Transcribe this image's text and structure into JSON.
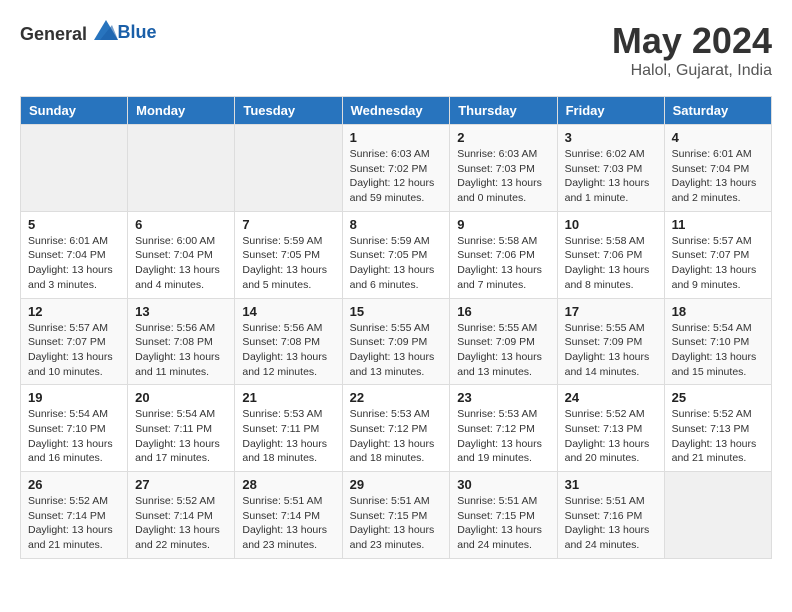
{
  "header": {
    "logo_general": "General",
    "logo_blue": "Blue",
    "title": "May 2024",
    "subtitle": "Halol, Gujarat, India"
  },
  "weekdays": [
    "Sunday",
    "Monday",
    "Tuesday",
    "Wednesday",
    "Thursday",
    "Friday",
    "Saturday"
  ],
  "weeks": [
    [
      {
        "day": "",
        "sunrise": "",
        "sunset": "",
        "daylight": ""
      },
      {
        "day": "",
        "sunrise": "",
        "sunset": "",
        "daylight": ""
      },
      {
        "day": "",
        "sunrise": "",
        "sunset": "",
        "daylight": ""
      },
      {
        "day": "1",
        "sunrise": "Sunrise: 6:03 AM",
        "sunset": "Sunset: 7:02 PM",
        "daylight": "Daylight: 12 hours and 59 minutes."
      },
      {
        "day": "2",
        "sunrise": "Sunrise: 6:03 AM",
        "sunset": "Sunset: 7:03 PM",
        "daylight": "Daylight: 13 hours and 0 minutes."
      },
      {
        "day": "3",
        "sunrise": "Sunrise: 6:02 AM",
        "sunset": "Sunset: 7:03 PM",
        "daylight": "Daylight: 13 hours and 1 minute."
      },
      {
        "day": "4",
        "sunrise": "Sunrise: 6:01 AM",
        "sunset": "Sunset: 7:04 PM",
        "daylight": "Daylight: 13 hours and 2 minutes."
      }
    ],
    [
      {
        "day": "5",
        "sunrise": "Sunrise: 6:01 AM",
        "sunset": "Sunset: 7:04 PM",
        "daylight": "Daylight: 13 hours and 3 minutes."
      },
      {
        "day": "6",
        "sunrise": "Sunrise: 6:00 AM",
        "sunset": "Sunset: 7:04 PM",
        "daylight": "Daylight: 13 hours and 4 minutes."
      },
      {
        "day": "7",
        "sunrise": "Sunrise: 5:59 AM",
        "sunset": "Sunset: 7:05 PM",
        "daylight": "Daylight: 13 hours and 5 minutes."
      },
      {
        "day": "8",
        "sunrise": "Sunrise: 5:59 AM",
        "sunset": "Sunset: 7:05 PM",
        "daylight": "Daylight: 13 hours and 6 minutes."
      },
      {
        "day": "9",
        "sunrise": "Sunrise: 5:58 AM",
        "sunset": "Sunset: 7:06 PM",
        "daylight": "Daylight: 13 hours and 7 minutes."
      },
      {
        "day": "10",
        "sunrise": "Sunrise: 5:58 AM",
        "sunset": "Sunset: 7:06 PM",
        "daylight": "Daylight: 13 hours and 8 minutes."
      },
      {
        "day": "11",
        "sunrise": "Sunrise: 5:57 AM",
        "sunset": "Sunset: 7:07 PM",
        "daylight": "Daylight: 13 hours and 9 minutes."
      }
    ],
    [
      {
        "day": "12",
        "sunrise": "Sunrise: 5:57 AM",
        "sunset": "Sunset: 7:07 PM",
        "daylight": "Daylight: 13 hours and 10 minutes."
      },
      {
        "day": "13",
        "sunrise": "Sunrise: 5:56 AM",
        "sunset": "Sunset: 7:08 PM",
        "daylight": "Daylight: 13 hours and 11 minutes."
      },
      {
        "day": "14",
        "sunrise": "Sunrise: 5:56 AM",
        "sunset": "Sunset: 7:08 PM",
        "daylight": "Daylight: 13 hours and 12 minutes."
      },
      {
        "day": "15",
        "sunrise": "Sunrise: 5:55 AM",
        "sunset": "Sunset: 7:09 PM",
        "daylight": "Daylight: 13 hours and 13 minutes."
      },
      {
        "day": "16",
        "sunrise": "Sunrise: 5:55 AM",
        "sunset": "Sunset: 7:09 PM",
        "daylight": "Daylight: 13 hours and 13 minutes."
      },
      {
        "day": "17",
        "sunrise": "Sunrise: 5:55 AM",
        "sunset": "Sunset: 7:09 PM",
        "daylight": "Daylight: 13 hours and 14 minutes."
      },
      {
        "day": "18",
        "sunrise": "Sunrise: 5:54 AM",
        "sunset": "Sunset: 7:10 PM",
        "daylight": "Daylight: 13 hours and 15 minutes."
      }
    ],
    [
      {
        "day": "19",
        "sunrise": "Sunrise: 5:54 AM",
        "sunset": "Sunset: 7:10 PM",
        "daylight": "Daylight: 13 hours and 16 minutes."
      },
      {
        "day": "20",
        "sunrise": "Sunrise: 5:54 AM",
        "sunset": "Sunset: 7:11 PM",
        "daylight": "Daylight: 13 hours and 17 minutes."
      },
      {
        "day": "21",
        "sunrise": "Sunrise: 5:53 AM",
        "sunset": "Sunset: 7:11 PM",
        "daylight": "Daylight: 13 hours and 18 minutes."
      },
      {
        "day": "22",
        "sunrise": "Sunrise: 5:53 AM",
        "sunset": "Sunset: 7:12 PM",
        "daylight": "Daylight: 13 hours and 18 minutes."
      },
      {
        "day": "23",
        "sunrise": "Sunrise: 5:53 AM",
        "sunset": "Sunset: 7:12 PM",
        "daylight": "Daylight: 13 hours and 19 minutes."
      },
      {
        "day": "24",
        "sunrise": "Sunrise: 5:52 AM",
        "sunset": "Sunset: 7:13 PM",
        "daylight": "Daylight: 13 hours and 20 minutes."
      },
      {
        "day": "25",
        "sunrise": "Sunrise: 5:52 AM",
        "sunset": "Sunset: 7:13 PM",
        "daylight": "Daylight: 13 hours and 21 minutes."
      }
    ],
    [
      {
        "day": "26",
        "sunrise": "Sunrise: 5:52 AM",
        "sunset": "Sunset: 7:14 PM",
        "daylight": "Daylight: 13 hours and 21 minutes."
      },
      {
        "day": "27",
        "sunrise": "Sunrise: 5:52 AM",
        "sunset": "Sunset: 7:14 PM",
        "daylight": "Daylight: 13 hours and 22 minutes."
      },
      {
        "day": "28",
        "sunrise": "Sunrise: 5:51 AM",
        "sunset": "Sunset: 7:14 PM",
        "daylight": "Daylight: 13 hours and 23 minutes."
      },
      {
        "day": "29",
        "sunrise": "Sunrise: 5:51 AM",
        "sunset": "Sunset: 7:15 PM",
        "daylight": "Daylight: 13 hours and 23 minutes."
      },
      {
        "day": "30",
        "sunrise": "Sunrise: 5:51 AM",
        "sunset": "Sunset: 7:15 PM",
        "daylight": "Daylight: 13 hours and 24 minutes."
      },
      {
        "day": "31",
        "sunrise": "Sunrise: 5:51 AM",
        "sunset": "Sunset: 7:16 PM",
        "daylight": "Daylight: 13 hours and 24 minutes."
      },
      {
        "day": "",
        "sunrise": "",
        "sunset": "",
        "daylight": ""
      }
    ]
  ]
}
